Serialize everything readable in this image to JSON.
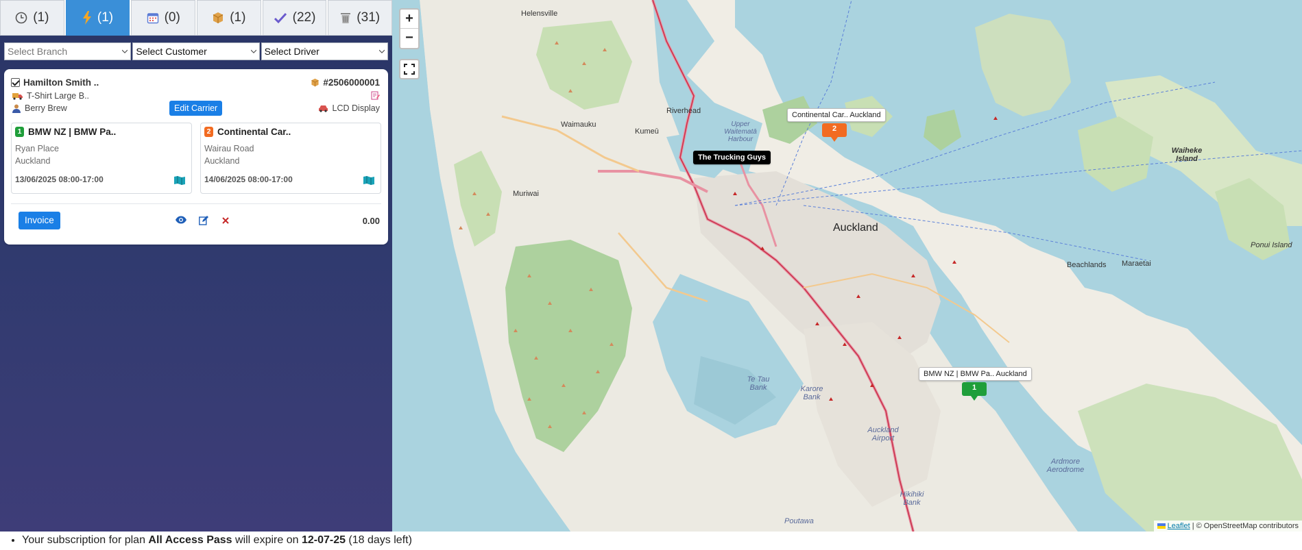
{
  "tabs": [
    {
      "icon": "clock-icon",
      "count": "(1)",
      "active": false
    },
    {
      "icon": "lightning-icon",
      "count": "(1)",
      "active": true
    },
    {
      "icon": "calendar-icon",
      "count": "(0)",
      "active": false
    },
    {
      "icon": "package-icon",
      "count": "(1)",
      "active": false
    },
    {
      "icon": "checkmark-icon",
      "count": "(22)",
      "active": false
    },
    {
      "icon": "trash-icon",
      "count": "(31)",
      "active": false
    }
  ],
  "filters": {
    "branch_placeholder": "Select Branch",
    "customer_value": "Select Customer",
    "driver_value": "Select Driver"
  },
  "order": {
    "customer": "Hamilton Smith ..",
    "order_number": "#2506000001",
    "item": "T-Shirt Large B..",
    "contact": "Berry Brew",
    "edit_carrier_label": "Edit Carrier",
    "vehicle": "LCD Display",
    "stops": [
      {
        "num": "1",
        "title": "BMW NZ | BMW Pa..",
        "addr1": "Ryan Place",
        "addr2": "Auckland",
        "date": "13/06/2025 08:00-17:00",
        "color": "#1f9e3a"
      },
      {
        "num": "2",
        "title": "Continental Car..",
        "addr1": "Wairau Road",
        "addr2": "Auckland",
        "date": "14/06/2025 08:00-17:00",
        "color": "#f26b21"
      }
    ],
    "invoice_label": "Invoice",
    "total": "0.00"
  },
  "map": {
    "zoom_in": "+",
    "zoom_out": "−",
    "tooltip_continental": "Continental Car.. Auckland",
    "tooltip_trucking": "The Trucking Guys",
    "tooltip_bmw": "BMW NZ | BMW Pa.. Auckland",
    "marker1": "1",
    "marker2": "2",
    "labels": {
      "helensville": "Helensville",
      "riverhead": "Riverhead",
      "waimauku": "Waimauku",
      "kumeu": "Kumeū",
      "muriwai": "Muriwai",
      "auckland": "Auckland",
      "waiheke": "Waiheke Island",
      "ponui": "Ponui Island",
      "beachlands": "Beachlands",
      "maraetai": "Maraetai",
      "airport": "Auckland Airport",
      "ardmore": "Ardmore Aerodrome",
      "tetau": "Te Tau Bank",
      "karore": "Karore Bank",
      "hikihiki": "Hikihiki Bank",
      "poutawa": "Poutawa",
      "upper_waitemata": "Upper Waitematā Harbour"
    },
    "attribution_link": "Leaflet",
    "attribution_text": "| © OpenStreetMap contributors"
  },
  "footer": {
    "pre": "Your subscription for plan ",
    "plan": "All Access Pass",
    "mid": " will expire on ",
    "date": "12-07-25",
    "post": " (18 days left)"
  }
}
